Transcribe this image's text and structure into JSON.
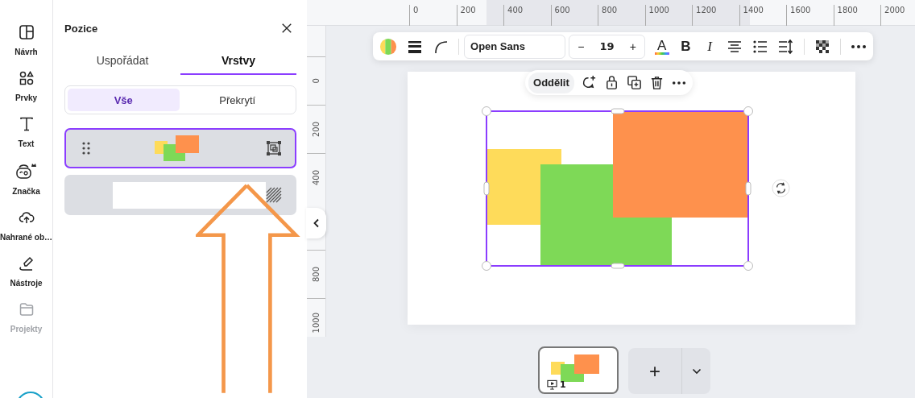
{
  "sidebar": {
    "items": [
      {
        "kind": "design",
        "label": "Návrh",
        "disabled": false
      },
      {
        "kind": "elements",
        "label": "Prvky",
        "disabled": false
      },
      {
        "kind": "text",
        "label": "Text",
        "disabled": false
      },
      {
        "kind": "brand",
        "label": "Značka",
        "disabled": false
      },
      {
        "kind": "uploads",
        "label": "Nahrané ob…",
        "disabled": false
      },
      {
        "kind": "tools",
        "label": "Nástroje",
        "disabled": false
      },
      {
        "kind": "projects",
        "label": "Projekty",
        "disabled": true
      }
    ]
  },
  "panel": {
    "title": "Pozice",
    "tabs": [
      {
        "label": "Uspořádat",
        "selected": false
      },
      {
        "label": "Vrstvy",
        "selected": true
      }
    ],
    "filters": [
      {
        "label": "Vše",
        "selected": true
      },
      {
        "label": "Překrytí",
        "selected": false
      }
    ],
    "layers": [
      {
        "kind": "group",
        "selected": true
      },
      {
        "kind": "background",
        "selected": false
      }
    ]
  },
  "ruler": {
    "marks": [
      "0",
      "200",
      "400",
      "600",
      "800",
      "1000",
      "1200",
      "1400",
      "1600",
      "1800",
      "2000"
    ]
  },
  "vertical_ruler": {
    "upper": [
      "0",
      "200",
      "400"
    ],
    "lower": [
      "800",
      "1000"
    ]
  },
  "toolbar": {
    "font": "Open Sans",
    "size_minus": "−",
    "font_size": "19",
    "size_plus": "+",
    "text_color": "A",
    "bold": "B",
    "italic": "I"
  },
  "context_menu": {
    "action": "Oddělit"
  },
  "pages": [
    {
      "number": "1",
      "selected": true
    }
  ],
  "add_page": "+"
}
